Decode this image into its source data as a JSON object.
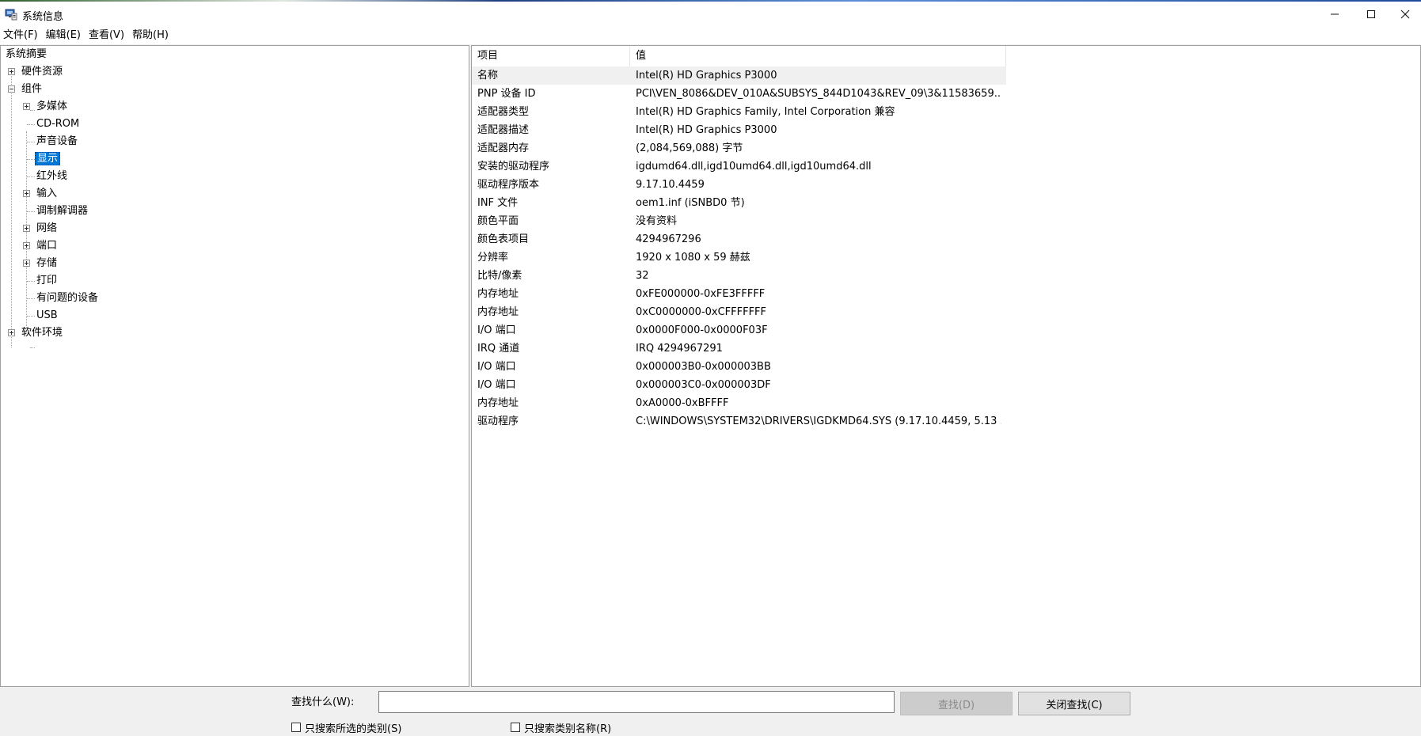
{
  "window": {
    "title": "系统信息"
  },
  "menu": [
    {
      "label": "文件(F)"
    },
    {
      "label": "编辑(E)"
    },
    {
      "label": "查看(V)"
    },
    {
      "label": "帮助(H)"
    }
  ],
  "tree": {
    "root": "系统摘要",
    "hardware": "硬件资源",
    "components": "组件",
    "children": [
      {
        "label": "多媒体",
        "expandable": true
      },
      {
        "label": "CD-ROM",
        "expandable": false
      },
      {
        "label": "声音设备",
        "expandable": false
      },
      {
        "label": "显示",
        "expandable": false,
        "selected": true
      },
      {
        "label": "红外线",
        "expandable": false
      },
      {
        "label": "输入",
        "expandable": true
      },
      {
        "label": "调制解调器",
        "expandable": false
      },
      {
        "label": "网络",
        "expandable": true
      },
      {
        "label": "端口",
        "expandable": true
      },
      {
        "label": "存储",
        "expandable": true
      },
      {
        "label": "打印",
        "expandable": false
      },
      {
        "label": "有问题的设备",
        "expandable": false
      },
      {
        "label": "USB",
        "expandable": false
      }
    ],
    "software": "软件环境"
  },
  "details": {
    "columns": {
      "item": "项目",
      "value": "值"
    },
    "rows": [
      {
        "name": "名称",
        "value": "Intel(R) HD Graphics P3000"
      },
      {
        "name": "PNP 设备 ID",
        "value": "PCI\\VEN_8086&DEV_010A&SUBSYS_844D1043&REV_09\\3&11583659..."
      },
      {
        "name": "适配器类型",
        "value": "Intel(R) HD Graphics Family, Intel Corporation 兼容"
      },
      {
        "name": "适配器描述",
        "value": "Intel(R) HD Graphics P3000"
      },
      {
        "name": "适配器内存",
        "value": "(2,084,569,088) 字节"
      },
      {
        "name": "安装的驱动程序",
        "value": "igdumd64.dll,igd10umd64.dll,igd10umd64.dll"
      },
      {
        "name": "驱动程序版本",
        "value": "9.17.10.4459"
      },
      {
        "name": "INF 文件",
        "value": "oem1.inf (iSNBD0 节)"
      },
      {
        "name": "颜色平面",
        "value": "没有资料"
      },
      {
        "name": "颜色表项目",
        "value": "4294967296"
      },
      {
        "name": "分辨率",
        "value": "1920 x 1080 x 59 赫兹"
      },
      {
        "name": "比特/像素",
        "value": "32"
      },
      {
        "name": "内存地址",
        "value": "0xFE000000-0xFE3FFFFF"
      },
      {
        "name": "内存地址",
        "value": "0xC0000000-0xCFFFFFFF"
      },
      {
        "name": "I/O 端口",
        "value": "0x0000F000-0x0000F03F"
      },
      {
        "name": "IRQ 通道",
        "value": "IRQ 4294967291"
      },
      {
        "name": "I/O 端口",
        "value": "0x000003B0-0x000003BB"
      },
      {
        "name": "I/O 端口",
        "value": "0x000003C0-0x000003DF"
      },
      {
        "name": "内存地址",
        "value": "0xA0000-0xBFFFF"
      },
      {
        "name": "驱动程序",
        "value": "C:\\WINDOWS\\SYSTEM32\\DRIVERS\\IGDKMD64.SYS (9.17.10.4459, 5.13 ..."
      }
    ]
  },
  "find": {
    "label": "查找什么(W):",
    "value": "",
    "find_button": "查找(D)",
    "close_button": "关闭查找(C)",
    "checkbox_selected": "只搜索所选的类别(S)",
    "checkbox_names": "只搜索类别名称(R)"
  },
  "icons": {
    "app": "system-info-icon",
    "minimize": "minimize-icon",
    "maximize": "maximize-icon",
    "close": "close-icon"
  }
}
